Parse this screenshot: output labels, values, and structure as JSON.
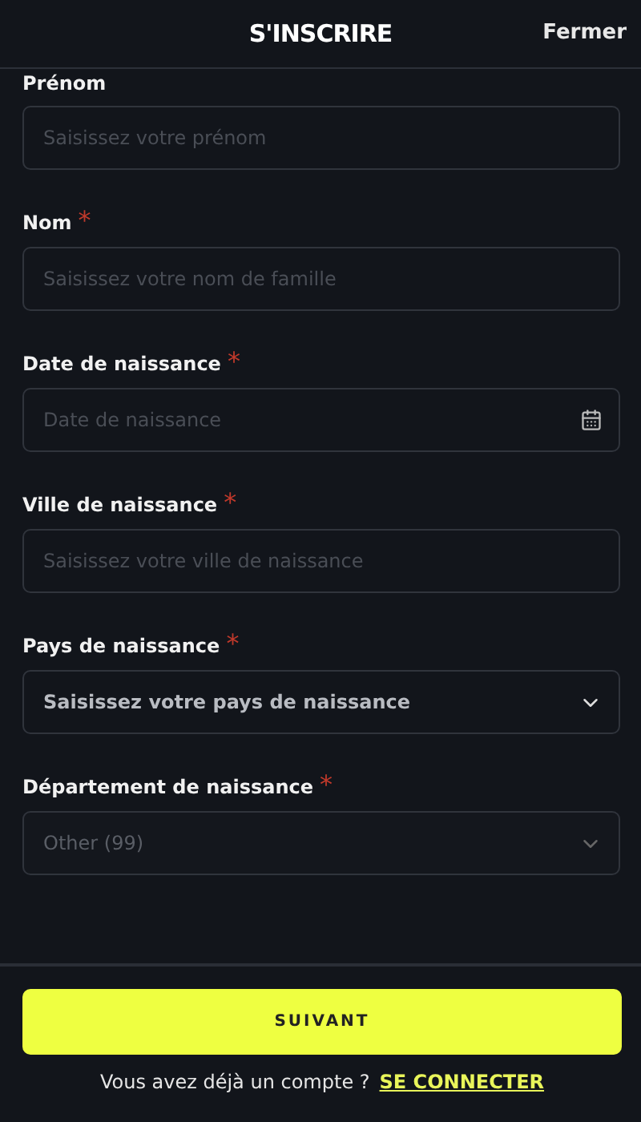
{
  "header": {
    "title": "S'INSCRIRE",
    "close": "Fermer"
  },
  "required_mark": "*",
  "fields": [
    {
      "kind": "text",
      "label": "Prénom",
      "required": false,
      "placeholder": "Saisissez votre prénom"
    },
    {
      "kind": "text",
      "label": "Nom",
      "required": true,
      "placeholder": "Saisissez votre nom de famille"
    },
    {
      "kind": "date",
      "label": "Date de naissance",
      "required": true,
      "placeholder": "Date de naissance"
    },
    {
      "kind": "text",
      "label": "Ville de naissance",
      "required": true,
      "placeholder": "Saisissez votre ville de naissance"
    },
    {
      "kind": "select",
      "label": "Pays de naissance",
      "required": true,
      "value": "Saisissez votre pays de naissance",
      "disabled": false
    },
    {
      "kind": "select",
      "label": "Département de naissance",
      "required": true,
      "value": "Other (99)",
      "disabled": true
    }
  ],
  "footer": {
    "button": "SUIVANT",
    "prompt": "Vous avez déjà un compte ?",
    "link": "SE CONNECTER"
  }
}
